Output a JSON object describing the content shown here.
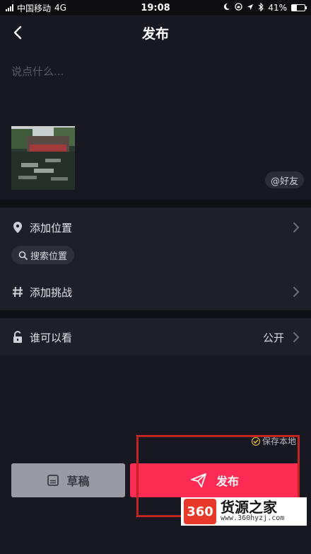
{
  "status_bar": {
    "carrier": "中国移动",
    "network": "4G",
    "time": "19:08",
    "battery": "41%",
    "battery_level": 0.41
  },
  "header": {
    "title": "发布"
  },
  "caption": {
    "placeholder": "说点什么..."
  },
  "mention": {
    "label": "@好友"
  },
  "location": {
    "label": "添加位置",
    "search_label": "搜索位置"
  },
  "challenge": {
    "label": "添加挑战"
  },
  "visibility": {
    "label": "谁可以看",
    "value": "公开"
  },
  "save_local": {
    "label": "保存本地"
  },
  "actions": {
    "draft_label": "草稿",
    "publish_label": "发布"
  },
  "watermark": {
    "logo": "360",
    "name": "货源之家",
    "url": "www.360hyzj.com"
  },
  "colors": {
    "background": "#171821",
    "section": "#1e1f29",
    "accent": "#fe2c55",
    "draft_button": "#9a9ba2",
    "highlight": "#c0261f"
  }
}
